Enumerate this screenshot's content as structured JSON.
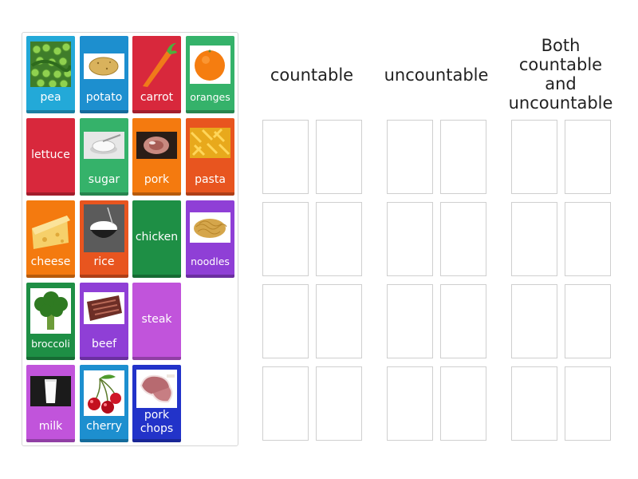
{
  "columns": {
    "countable": "countable",
    "uncountable": "uncountable",
    "both": [
      "Both",
      "countable",
      "and",
      "uncountable"
    ]
  },
  "cards": [
    {
      "label": "pea",
      "icon": "peas-icon",
      "color": "#23a9d8"
    },
    {
      "label": "potato",
      "icon": "potato-icon",
      "color": "#1d8fcf"
    },
    {
      "label": "carrot",
      "icon": "carrot-icon",
      "color": "#d8283c"
    },
    {
      "label": "oranges",
      "icon": "orange-icon",
      "color": "#35b26a"
    },
    {
      "label": "lettuce",
      "icon": null,
      "color": "#d8283c"
    },
    {
      "label": "sugar",
      "icon": "sugar-bowl-icon",
      "color": "#35b26a"
    },
    {
      "label": "pork",
      "icon": "pork-icon",
      "color": "#f47a0f"
    },
    {
      "label": "pasta",
      "icon": "pasta-icon",
      "color": "#e8551f"
    },
    {
      "label": "cheese",
      "icon": "cheese-icon",
      "color": "#f47a0f"
    },
    {
      "label": "rice",
      "icon": "rice-bowl-icon",
      "color": "#e8551f"
    },
    {
      "label": "chicken",
      "icon": null,
      "color": "#1e8f45"
    },
    {
      "label": "noodles",
      "icon": "noodles-icon",
      "color": "#8f3fd6"
    },
    {
      "label": "broccoli",
      "icon": "broccoli-icon",
      "color": "#1e8f45"
    },
    {
      "label": "beef",
      "icon": "beef-icon",
      "color": "#8f3fd6"
    },
    {
      "label": "steak",
      "icon": null,
      "color": "#c154db"
    },
    {
      "label": "milk",
      "icon": "milk-glass-icon",
      "color": "#c154db"
    },
    {
      "label": "cherry",
      "icon": "cherry-icon",
      "color": "#1d8fcf"
    },
    {
      "label": "pork chops",
      "icon": "pork-chops-icon",
      "color": "#2233c9"
    }
  ]
}
